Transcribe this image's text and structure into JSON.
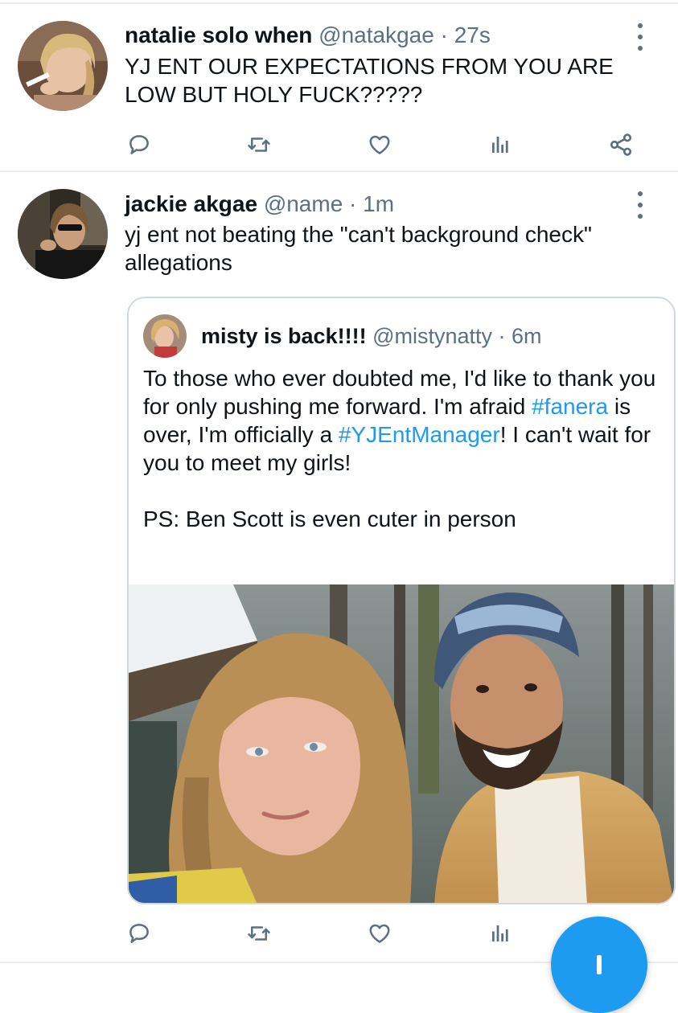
{
  "tweets": [
    {
      "display_name": "natalie solo when",
      "handle": "@natakgae",
      "time": "27s",
      "text": "YJ ENT OUR EXPECTATIONS FROM YOU ARE\nLOW BUT HOLY FUCK?????"
    },
    {
      "display_name": "jackie akgae",
      "handle": "@name",
      "time": "1m",
      "text": "yj ent not beating the \"can't background check\"\nallegations",
      "quote": {
        "display_name": "misty is back!!!!",
        "handle": "@mistynatty",
        "time": "6m",
        "line1_pre": "To those who ever doubted me, I'd like to thank you for only pushing me forward. I'm afraid ",
        "hashtag1": "#fanera",
        "line1_mid": " is over, I'm officially a ",
        "hashtag2": "#YJEntManager",
        "line1_post": "! I can't wait for you to meet my girls!",
        "line2": "PS: Ben Scott is even cuter in person"
      }
    }
  ],
  "sep": " · ",
  "icons": [
    "reply-icon",
    "retweet-icon",
    "like-icon",
    "analytics-icon",
    "share-icon",
    "more-icon",
    "compose-icon"
  ],
  "colors": {
    "accent": "#1d9bf0",
    "secondary_text": "#5b7083",
    "divider": "#e6ecf0"
  }
}
